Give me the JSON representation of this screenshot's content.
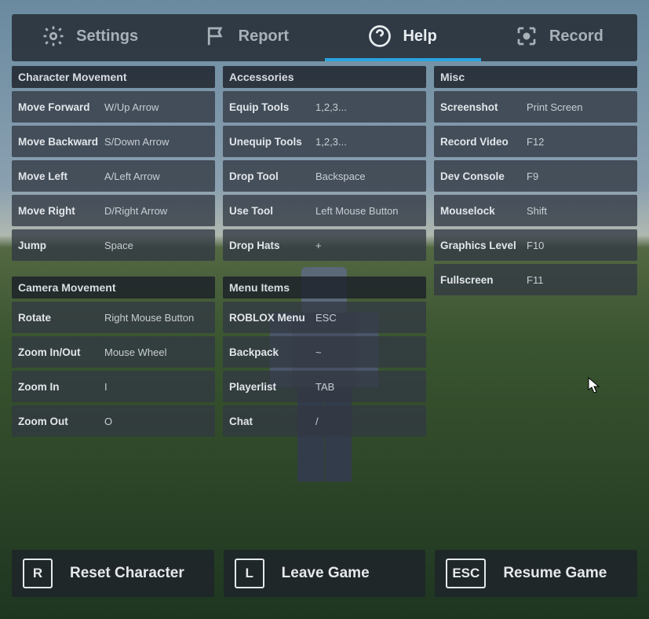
{
  "tabs": {
    "settings": "Settings",
    "report": "Report",
    "help": "Help",
    "record": "Record",
    "active": "help"
  },
  "sections": {
    "character_movement": {
      "title": "Character Movement",
      "items": [
        {
          "label": "Move Forward",
          "value": "W/Up Arrow"
        },
        {
          "label": "Move Backward",
          "value": "S/Down Arrow"
        },
        {
          "label": "Move Left",
          "value": "A/Left Arrow"
        },
        {
          "label": "Move Right",
          "value": "D/Right Arrow"
        },
        {
          "label": "Jump",
          "value": "Space"
        }
      ]
    },
    "accessories": {
      "title": "Accessories",
      "items": [
        {
          "label": "Equip Tools",
          "value": "1,2,3..."
        },
        {
          "label": "Unequip Tools",
          "value": "1,2,3..."
        },
        {
          "label": "Drop Tool",
          "value": "Backspace"
        },
        {
          "label": "Use Tool",
          "value": "Left Mouse Button"
        },
        {
          "label": "Drop Hats",
          "value": "+"
        }
      ]
    },
    "misc": {
      "title": "Misc",
      "items": [
        {
          "label": "Screenshot",
          "value": "Print Screen"
        },
        {
          "label": "Record Video",
          "value": "F12"
        },
        {
          "label": "Dev Console",
          "value": "F9"
        },
        {
          "label": "Mouselock",
          "value": "Shift"
        },
        {
          "label": "Graphics Level",
          "value": "F10"
        },
        {
          "label": "Fullscreen",
          "value": "F11"
        }
      ]
    },
    "camera_movement": {
      "title": "Camera Movement",
      "items": [
        {
          "label": "Rotate",
          "value": "Right Mouse Button"
        },
        {
          "label": "Zoom In/Out",
          "value": "Mouse Wheel"
        },
        {
          "label": "Zoom In",
          "value": "I"
        },
        {
          "label": "Zoom Out",
          "value": "O"
        }
      ]
    },
    "menu_items": {
      "title": "Menu Items",
      "items": [
        {
          "label": "ROBLOX Menu",
          "value": "ESC"
        },
        {
          "label": "Backpack",
          "value": "~"
        },
        {
          "label": "Playerlist",
          "value": "TAB"
        },
        {
          "label": "Chat",
          "value": "/"
        }
      ]
    }
  },
  "footer": {
    "reset": {
      "key": "R",
      "label": "Reset Character"
    },
    "leave": {
      "key": "L",
      "label": "Leave Game"
    },
    "resume": {
      "key": "ESC",
      "label": "Resume Game"
    }
  }
}
